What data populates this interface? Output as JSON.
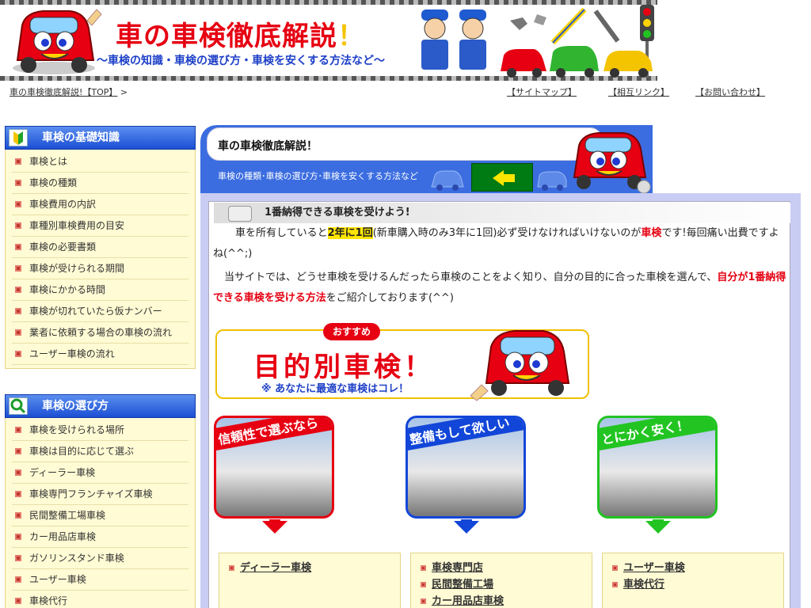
{
  "header": {
    "title_a": "車の車検",
    "title_b": "徹底解説",
    "title_mark": "！",
    "subtitle": "～車検の知識・車検の選び方・車検を安くする方法など～"
  },
  "breadcrumb": {
    "link": "車の車検徹底解説!【TOP】",
    "sep": ">"
  },
  "toplinks": [
    {
      "pre": "【",
      "label": "サイトマップ",
      "post": "】"
    },
    {
      "pre": "【",
      "label": "相互リンク",
      "post": "】"
    },
    {
      "pre": "【",
      "label": "お問い合わせ",
      "post": "】"
    }
  ],
  "sidebar": {
    "sections": [
      {
        "title": "車検の基礎知識",
        "icon": "beginner-mark-icon",
        "items": [
          "車検とは",
          "車検の種類",
          "車検費用の内訳",
          "車種別車検費用の目安",
          "車検の必要書類",
          "車検が受けられる期間",
          "車検にかかる時間",
          "車検が切れていたら仮ナンバー",
          "業者に依頼する場合の車検の流れ",
          "ユーザー車検の流れ"
        ]
      },
      {
        "title": "車検の選び方",
        "icon": "magnifier-icon",
        "items": [
          "車検を受けられる場所",
          "車検は目的に応じて選ぶ",
          "ディーラー車検",
          "車検専門フランチャイズ車検",
          "民間整備工場車検",
          "カー用品店車検",
          "ガソリンスタンド車検",
          "ユーザー車検",
          "車検代行"
        ]
      }
    ]
  },
  "main": {
    "head_title": "車の車検徹底解説！",
    "head_sub": "車検の種類･車検の選び方･車検を安くする方法など",
    "section_title": "1番納得できる車検を受けよう!",
    "p1": {
      "a": "車を所有していると",
      "b": "2年に1回",
      "c": "(新車購入時のみ3年に1回)必ず受けなければいけないのが",
      "d": "車検",
      "e": "です!毎回痛い出費ですよね(^^;)"
    },
    "p2": {
      "a": "当サイトでは、どうせ車検を受けるんだったら車検のことをよく知り、自分の目的に合った車検を選んで、",
      "b": "自分が1番納得できる車検を受ける方法",
      "c": "をご紹介しております(^^)"
    },
    "reco": {
      "badge": "おすすめ",
      "big": "目的別車検",
      "mark": "！",
      "small": "※ あなたに最適な車検はコレ！"
    },
    "choices": [
      {
        "caption": "信頼性で選ぶなら",
        "color": "#e60012",
        "links": [
          "ディーラー車検"
        ]
      },
      {
        "caption": "整備もして欲しい",
        "color": "#1246d8",
        "links": [
          "車検専門店",
          "民間整備工場",
          "カー用品店車検"
        ]
      },
      {
        "caption": "とにかく安く！",
        "color": "#22c422",
        "links": [
          "ユーザー車検",
          "車検代行"
        ]
      }
    ]
  }
}
